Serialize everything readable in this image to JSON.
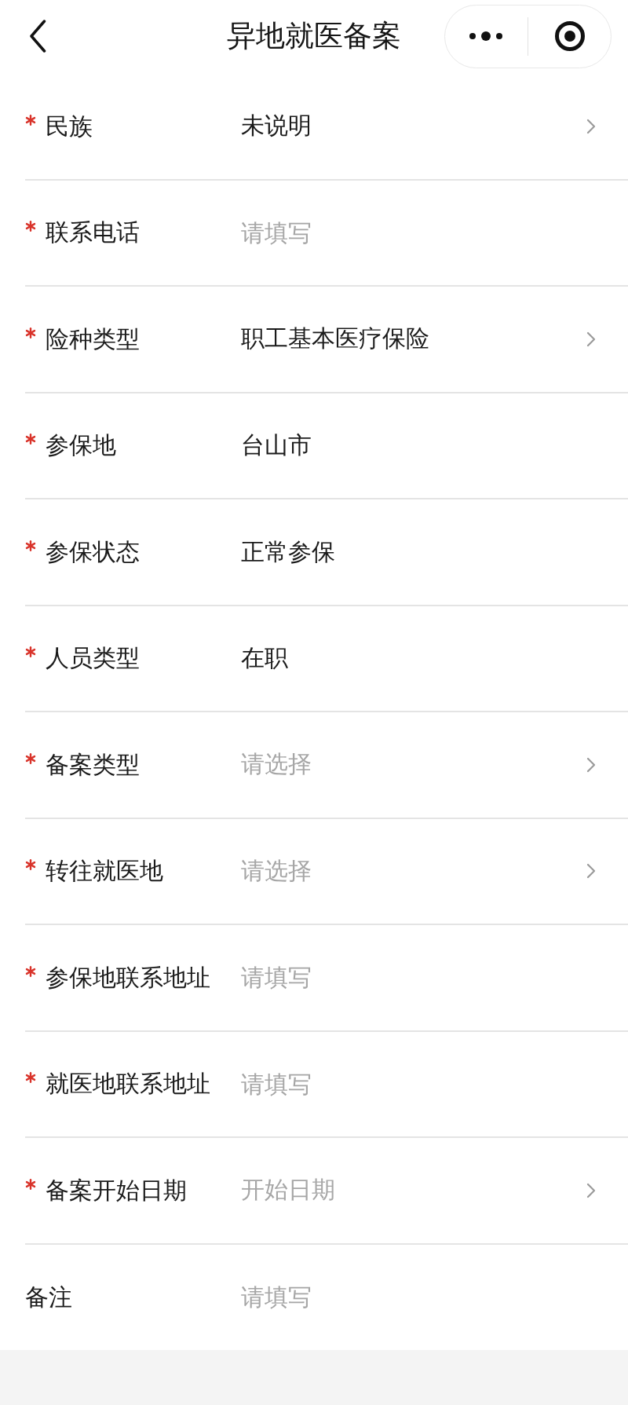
{
  "nav_bar": {
    "title": "异地就医备案"
  },
  "form": {
    "rows": [
      {
        "label": "民族",
        "required": true,
        "kind": "picker",
        "value": "未说明"
      },
      {
        "label": "联系电话",
        "required": true,
        "kind": "input",
        "placeholder": "请填写"
      },
      {
        "label": "险种类型",
        "required": true,
        "kind": "picker",
        "value": "职工基本医疗保险"
      },
      {
        "label": "参保地",
        "required": true,
        "kind": "display",
        "value": "台山市"
      },
      {
        "label": "参保状态",
        "required": true,
        "kind": "display",
        "value": "正常参保"
      },
      {
        "label": "人员类型",
        "required": true,
        "kind": "display",
        "value": "在职"
      },
      {
        "label": "备案类型",
        "required": true,
        "kind": "picker",
        "placeholder": "请选择"
      },
      {
        "label": "转往就医地",
        "required": true,
        "kind": "picker",
        "placeholder": "请选择"
      },
      {
        "label": "参保地联系地址",
        "required": true,
        "kind": "input",
        "placeholder": "请填写"
      },
      {
        "label": "就医地联系地址",
        "required": true,
        "kind": "input",
        "placeholder": "请填写"
      },
      {
        "label": "备案开始日期",
        "required": true,
        "kind": "picker",
        "placeholder": "开始日期"
      },
      {
        "label": "备注",
        "required": false,
        "kind": "input",
        "placeholder": "请填写"
      }
    ]
  }
}
